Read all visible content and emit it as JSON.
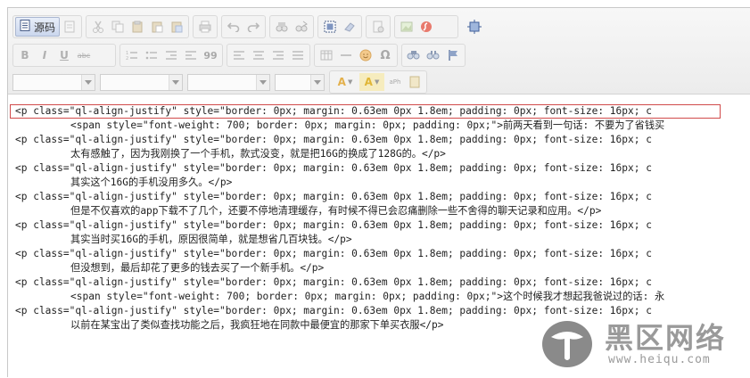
{
  "toolbar": {
    "source_label": "源码",
    "bold_label": "B",
    "italic_label": "I",
    "underline_label": "U",
    "strike_label": "abc",
    "quote_label": "99",
    "textcolor_label": "A",
    "bgcolor_label": "A",
    "small_text_label": "aPh",
    "omega_label": "Ω",
    "icons": [
      "source-icon",
      "preview-icon",
      "cut-icon",
      "copy-icon",
      "paste-icon",
      "paste-text-icon",
      "paste-word-icon",
      "print-icon",
      "undo-icon",
      "redo-icon",
      "find-icon",
      "replace-icon",
      "select-all-icon",
      "remove-format-icon",
      "template-icon",
      "image-icon",
      "flash-icon",
      "maximize-icon",
      "numbered-list-icon",
      "bulleted-list-icon",
      "outdent-icon",
      "indent-icon",
      "blockquote-icon",
      "align-left-icon",
      "align-center-icon",
      "align-right-icon",
      "justify-icon",
      "table-icon",
      "horizontal-rule-icon",
      "smiley-icon",
      "special-char-icon",
      "link-icon",
      "unlink-icon",
      "anchor-icon"
    ],
    "combos": [
      "",
      "",
      "",
      ""
    ]
  },
  "code": {
    "lines": [
      "<p class=\"ql-align-justify\" style=\"border: 0px; margin: 0.63em 0px 1.8em; padding: 0px; font-size: 16px; c",
      "<span style=\"font-weight: 700; border: 0px; margin: 0px; padding: 0px;\">前两天看到一句话: 不要为了省钱买",
      "<p class=\"ql-align-justify\" style=\"border: 0px; margin: 0.63em 0px 1.8em; padding: 0px; font-size: 16px; c",
      "太有感触了，因为我刚换了一个手机，款式没变，就是把16G的换成了128G的。</p>",
      "<p class=\"ql-align-justify\" style=\"border: 0px; margin: 0.63em 0px 1.8em; padding: 0px; font-size: 16px; c",
      "其实这个16G的手机没用多久。</p>",
      "<p class=\"ql-align-justify\" style=\"border: 0px; margin: 0.63em 0px 1.8em; padding: 0px; font-size: 16px; c",
      "但是不仅喜欢的app下载不了几个，还要不停地清理缓存，有时候不得已会忍痛删除一些不舍得的聊天记录和应用。</p>",
      "<p class=\"ql-align-justify\" style=\"border: 0px; margin: 0.63em 0px 1.8em; padding: 0px; font-size: 16px; c",
      "其实当时买16G的手机，原因很简单，就是想省几百块钱。</p>",
      "<p class=\"ql-align-justify\" style=\"border: 0px; margin: 0.63em 0px 1.8em; padding: 0px; font-size: 16px; c",
      "但没想到，最后却花了更多的钱去买了一个新手机。</p>",
      "<p class=\"ql-align-justify\" style=\"border: 0px; margin: 0.63em 0px 1.8em; padding: 0px; font-size: 16px; c",
      "<span style=\"font-weight: 700; border: 0px; margin: 0px; padding: 0px;\">这个时候我才想起我爸说过的话: 永",
      "<p class=\"ql-align-justify\" style=\"border: 0px; margin: 0.63em 0px 1.8em; padding: 0px; font-size: 16px; c",
      "以前在某宝出了类似查找功能之后，我疯狂地在同款中最便宜的那家下单买衣服</p>"
    ]
  },
  "watermark": {
    "title": "黑区网络",
    "url": "www.heiqu.com"
  },
  "colors": {
    "highlight_border": "#d04a4a",
    "toolbar_bg": "#ececec",
    "watermark_gray": "#9a9a9a"
  }
}
